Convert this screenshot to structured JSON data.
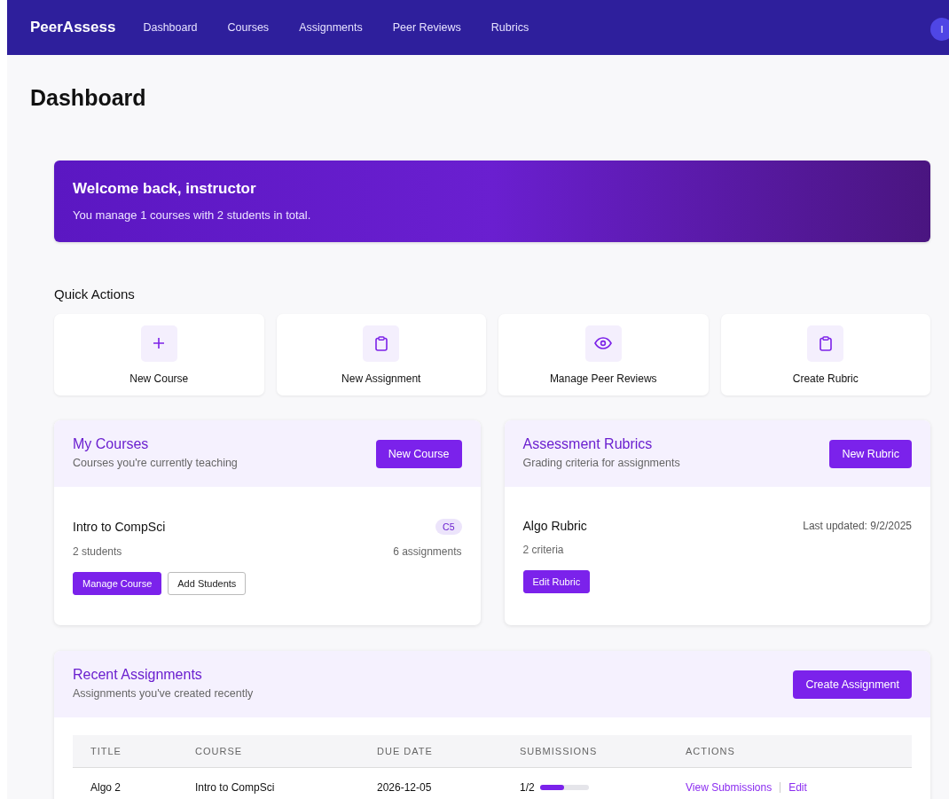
{
  "nav": {
    "brand": "PeerAssess",
    "items": [
      {
        "label": "Dashboard",
        "selected": false
      },
      {
        "label": "Courses",
        "selected": false
      },
      {
        "label": "Assignments",
        "selected": false
      },
      {
        "label": "Peer Reviews",
        "selected": false
      },
      {
        "label": "Rubrics",
        "selected": false
      }
    ],
    "avatar": "I"
  },
  "page_title": "Dashboard",
  "welcome": {
    "title": "Welcome back, instructor",
    "text": "You manage 1 courses with 2 students in total."
  },
  "quick_actions": {
    "title": "Quick Actions",
    "items": [
      {
        "kind": "plus",
        "label": "New Course"
      },
      {
        "kind": "clipboard",
        "label": "New Assignment"
      },
      {
        "kind": "eye",
        "label": "Manage Peer Reviews"
      },
      {
        "kind": "clipboard",
        "label": "Create Rubric"
      }
    ]
  },
  "my_courses": {
    "title": "My Courses",
    "subtitle": "Courses you're currently teaching",
    "button": "New Course",
    "courses": [
      {
        "name": "Intro to CompSci",
        "code": "C5",
        "students": "2 students",
        "assignments": "6 assignments",
        "buttons": [
          "Manage Course",
          "Add Students"
        ]
      }
    ]
  },
  "rubrics": {
    "title": "Assessment Rubrics",
    "subtitle": "Grading criteria for assignments",
    "button": "New Rubric",
    "items": [
      {
        "name": "Algo Rubric",
        "updated": "Last updated: 9/2/2025",
        "criteria": "2 criteria",
        "button": "Edit Rubric"
      }
    ]
  },
  "recent": {
    "title": "Recent Assignments",
    "subtitle": "Assignments you've created recently",
    "button": "Create Assignment",
    "columns": [
      "TITLE",
      "COURSE",
      "DUE DATE",
      "SUBMISSIONS",
      "ACTIONS"
    ],
    "rows": [
      {
        "title": "Algo 2",
        "course": "Intro to CompSci",
        "due": "2026-12-05",
        "submissions": "1/2",
        "level": 0.5,
        "actions": [
          "View Submissions",
          "Edit"
        ]
      }
    ]
  }
}
